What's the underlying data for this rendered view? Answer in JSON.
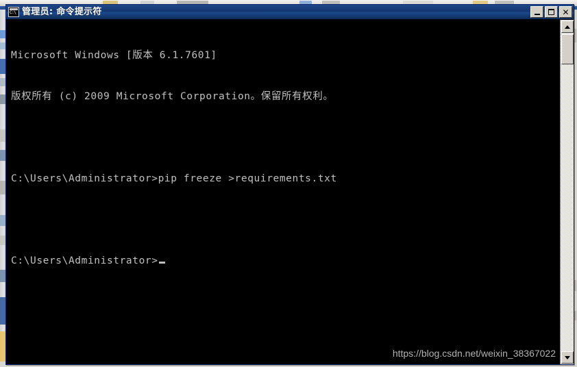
{
  "window": {
    "title": "管理员: 命令提示符",
    "icon": "cmd-icon",
    "controls": {
      "minimize_label": "最小化",
      "maximize_label": "最大化",
      "close_label": "关闭"
    }
  },
  "console": {
    "lines": [
      "Microsoft Windows [版本 6.1.7601]",
      "版权所有 (c) 2009 Microsoft Corporation。保留所有权利。",
      "",
      "C:\\Users\\Administrator>pip freeze >requirements.txt",
      "",
      "C:\\Users\\Administrator>"
    ],
    "prompt": "C:\\Users\\Administrator>",
    "command": "pip freeze >requirements.txt",
    "cursor_visible": true,
    "foreground_color": "#c0c0c0",
    "background_color": "#000000"
  },
  "scrollbar": {
    "up_arrow": "scroll-up-arrow",
    "down_arrow": "scroll-down-arrow",
    "thumb_label": "scroll-thumb"
  },
  "watermark": {
    "text": "https://blog.csdn.net/weixin_38367022"
  },
  "background": {
    "titlebar_color": "#2a5699",
    "chrome_color": "#d4d0c8"
  }
}
